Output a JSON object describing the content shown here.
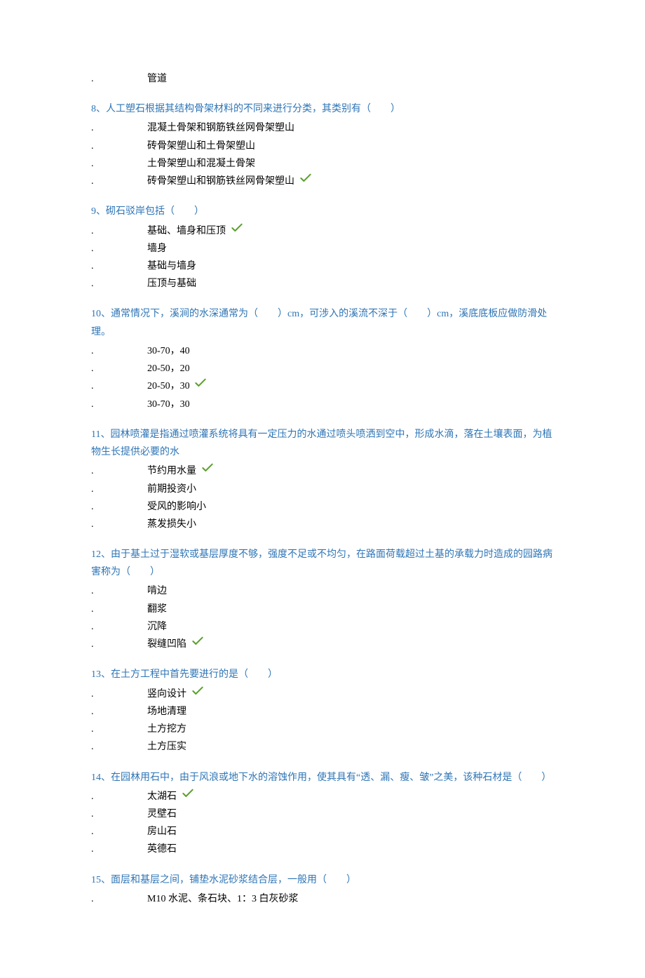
{
  "questions": [
    {
      "id": "q7_tail",
      "title": "",
      "options": [
        {
          "label": "管道",
          "correct": false
        }
      ]
    },
    {
      "id": "q8",
      "title": "8、人工塑石根据其结构骨架材料的不同来进行分类，其类别有（　　）",
      "options": [
        {
          "label": "混凝土骨架和钢筋铁丝网骨架塑山",
          "correct": false
        },
        {
          "label": "砖骨架塑山和土骨架塑山",
          "correct": false
        },
        {
          "label": "土骨架塑山和混凝土骨架",
          "correct": false
        },
        {
          "label": "砖骨架塑山和钢筋铁丝网骨架塑山",
          "correct": true
        }
      ]
    },
    {
      "id": "q9",
      "title": "9、砌石驳岸包括（　　）",
      "options": [
        {
          "label": "基础、墙身和压顶",
          "correct": true
        },
        {
          "label": "墙身",
          "correct": false
        },
        {
          "label": "基础与墙身",
          "correct": false
        },
        {
          "label": "压顶与基础",
          "correct": false
        }
      ]
    },
    {
      "id": "q10",
      "title": "10、通常情况下，溪涧的水深通常为（　　）cm，可涉入的溪流不深于（　　）cm，溪底底板应做防滑处理。",
      "options": [
        {
          "label": "30-70，40",
          "correct": false
        },
        {
          "label": "20-50，20",
          "correct": false
        },
        {
          "label": "20-50，30",
          "correct": true
        },
        {
          "label": "30-70，30",
          "correct": false
        }
      ]
    },
    {
      "id": "q11",
      "title": "11、园林喷灌是指通过喷灌系统将具有一定压力的水通过喷头喷洒到空中，形成水滴，落在土壤表面，为植物生长提供必要的水",
      "options": [
        {
          "label": "节约用水量",
          "correct": true
        },
        {
          "label": "前期投资小",
          "correct": false
        },
        {
          "label": "受风的影响小",
          "correct": false
        },
        {
          "label": "蒸发损失小",
          "correct": false
        }
      ]
    },
    {
      "id": "q12",
      "title": "12、由于基土过于湿软或基层厚度不够，强度不足或不均匀，在路面荷载超过土基的承载力时造成的园路病害称为（　　）",
      "options": [
        {
          "label": "啃边",
          "correct": false
        },
        {
          "label": "翻浆",
          "correct": false
        },
        {
          "label": "沉降",
          "correct": false
        },
        {
          "label": "裂缝凹陷",
          "correct": true
        }
      ]
    },
    {
      "id": "q13",
      "title": "13、在土方工程中首先要进行的是（　　）",
      "options": [
        {
          "label": "竖向设计",
          "correct": true
        },
        {
          "label": "场地清理",
          "correct": false
        },
        {
          "label": "土方挖方",
          "correct": false
        },
        {
          "label": "土方压实",
          "correct": false
        }
      ]
    },
    {
      "id": "q14",
      "title": "14、在园林用石中，由于风浪或地下水的溶蚀作用，使其具有“透、漏、瘦、皱”之美，该种石材是（　　）",
      "options": [
        {
          "label": "太湖石",
          "correct": true
        },
        {
          "label": "灵壁石",
          "correct": false
        },
        {
          "label": "房山石",
          "correct": false
        },
        {
          "label": "英德石",
          "correct": false
        }
      ]
    },
    {
      "id": "q15",
      "title": "15、面层和基层之间，铺垫水泥砂浆结合层，一般用（　　）",
      "options": [
        {
          "label": "M10 水泥、条石块、1：3 白灰砂浆",
          "correct": false
        }
      ]
    }
  ],
  "bullet": "."
}
